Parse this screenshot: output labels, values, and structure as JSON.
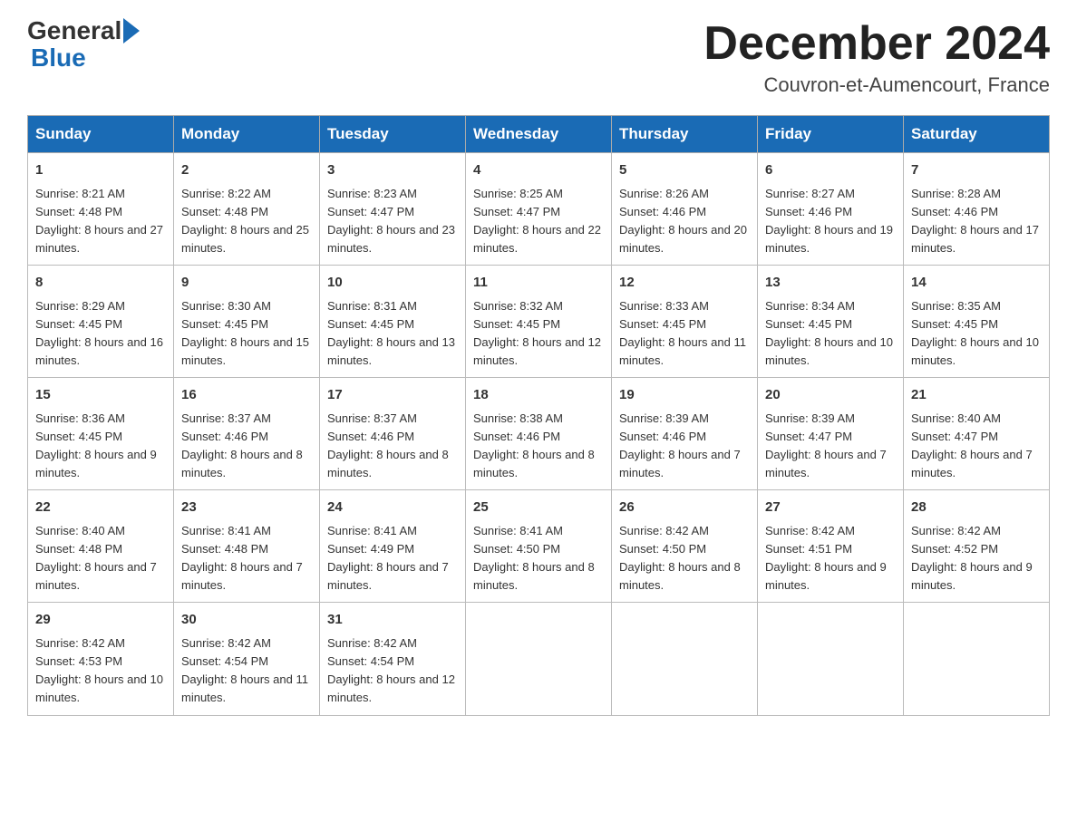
{
  "header": {
    "logo_general": "General",
    "logo_blue": "Blue",
    "title": "December 2024",
    "location": "Couvron-et-Aumencourt, France"
  },
  "weekdays": [
    "Sunday",
    "Monday",
    "Tuesday",
    "Wednesday",
    "Thursday",
    "Friday",
    "Saturday"
  ],
  "weeks": [
    [
      {
        "day": "1",
        "sunrise": "8:21 AM",
        "sunset": "4:48 PM",
        "daylight": "8 hours and 27 minutes."
      },
      {
        "day": "2",
        "sunrise": "8:22 AM",
        "sunset": "4:48 PM",
        "daylight": "8 hours and 25 minutes."
      },
      {
        "day": "3",
        "sunrise": "8:23 AM",
        "sunset": "4:47 PM",
        "daylight": "8 hours and 23 minutes."
      },
      {
        "day": "4",
        "sunrise": "8:25 AM",
        "sunset": "4:47 PM",
        "daylight": "8 hours and 22 minutes."
      },
      {
        "day": "5",
        "sunrise": "8:26 AM",
        "sunset": "4:46 PM",
        "daylight": "8 hours and 20 minutes."
      },
      {
        "day": "6",
        "sunrise": "8:27 AM",
        "sunset": "4:46 PM",
        "daylight": "8 hours and 19 minutes."
      },
      {
        "day": "7",
        "sunrise": "8:28 AM",
        "sunset": "4:46 PM",
        "daylight": "8 hours and 17 minutes."
      }
    ],
    [
      {
        "day": "8",
        "sunrise": "8:29 AM",
        "sunset": "4:45 PM",
        "daylight": "8 hours and 16 minutes."
      },
      {
        "day": "9",
        "sunrise": "8:30 AM",
        "sunset": "4:45 PM",
        "daylight": "8 hours and 15 minutes."
      },
      {
        "day": "10",
        "sunrise": "8:31 AM",
        "sunset": "4:45 PM",
        "daylight": "8 hours and 13 minutes."
      },
      {
        "day": "11",
        "sunrise": "8:32 AM",
        "sunset": "4:45 PM",
        "daylight": "8 hours and 12 minutes."
      },
      {
        "day": "12",
        "sunrise": "8:33 AM",
        "sunset": "4:45 PM",
        "daylight": "8 hours and 11 minutes."
      },
      {
        "day": "13",
        "sunrise": "8:34 AM",
        "sunset": "4:45 PM",
        "daylight": "8 hours and 10 minutes."
      },
      {
        "day": "14",
        "sunrise": "8:35 AM",
        "sunset": "4:45 PM",
        "daylight": "8 hours and 10 minutes."
      }
    ],
    [
      {
        "day": "15",
        "sunrise": "8:36 AM",
        "sunset": "4:45 PM",
        "daylight": "8 hours and 9 minutes."
      },
      {
        "day": "16",
        "sunrise": "8:37 AM",
        "sunset": "4:46 PM",
        "daylight": "8 hours and 8 minutes."
      },
      {
        "day": "17",
        "sunrise": "8:37 AM",
        "sunset": "4:46 PM",
        "daylight": "8 hours and 8 minutes."
      },
      {
        "day": "18",
        "sunrise": "8:38 AM",
        "sunset": "4:46 PM",
        "daylight": "8 hours and 8 minutes."
      },
      {
        "day": "19",
        "sunrise": "8:39 AM",
        "sunset": "4:46 PM",
        "daylight": "8 hours and 7 minutes."
      },
      {
        "day": "20",
        "sunrise": "8:39 AM",
        "sunset": "4:47 PM",
        "daylight": "8 hours and 7 minutes."
      },
      {
        "day": "21",
        "sunrise": "8:40 AM",
        "sunset": "4:47 PM",
        "daylight": "8 hours and 7 minutes."
      }
    ],
    [
      {
        "day": "22",
        "sunrise": "8:40 AM",
        "sunset": "4:48 PM",
        "daylight": "8 hours and 7 minutes."
      },
      {
        "day": "23",
        "sunrise": "8:41 AM",
        "sunset": "4:48 PM",
        "daylight": "8 hours and 7 minutes."
      },
      {
        "day": "24",
        "sunrise": "8:41 AM",
        "sunset": "4:49 PM",
        "daylight": "8 hours and 7 minutes."
      },
      {
        "day": "25",
        "sunrise": "8:41 AM",
        "sunset": "4:50 PM",
        "daylight": "8 hours and 8 minutes."
      },
      {
        "day": "26",
        "sunrise": "8:42 AM",
        "sunset": "4:50 PM",
        "daylight": "8 hours and 8 minutes."
      },
      {
        "day": "27",
        "sunrise": "8:42 AM",
        "sunset": "4:51 PM",
        "daylight": "8 hours and 9 minutes."
      },
      {
        "day": "28",
        "sunrise": "8:42 AM",
        "sunset": "4:52 PM",
        "daylight": "8 hours and 9 minutes."
      }
    ],
    [
      {
        "day": "29",
        "sunrise": "8:42 AM",
        "sunset": "4:53 PM",
        "daylight": "8 hours and 10 minutes."
      },
      {
        "day": "30",
        "sunrise": "8:42 AM",
        "sunset": "4:54 PM",
        "daylight": "8 hours and 11 minutes."
      },
      {
        "day": "31",
        "sunrise": "8:42 AM",
        "sunset": "4:54 PM",
        "daylight": "8 hours and 12 minutes."
      },
      null,
      null,
      null,
      null
    ]
  ]
}
